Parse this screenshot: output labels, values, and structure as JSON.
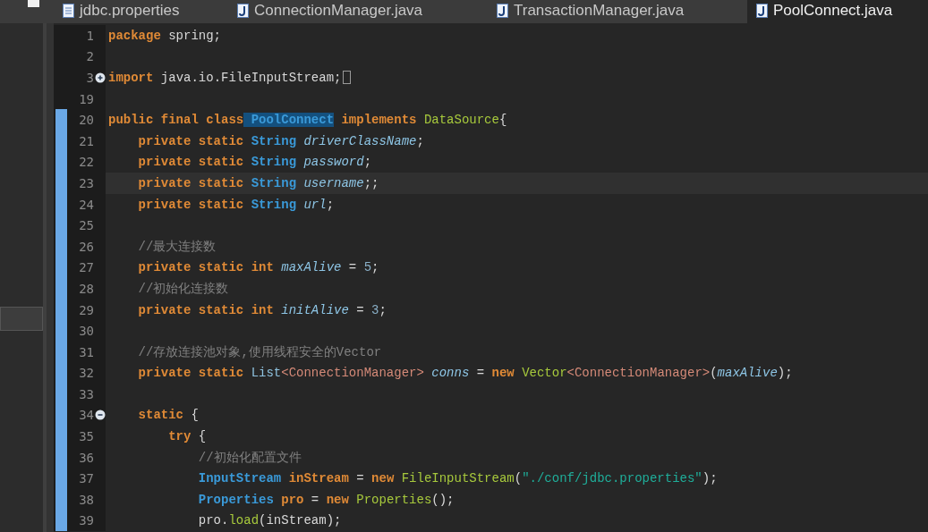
{
  "tabs": [
    {
      "label": "jdbc.properties",
      "kind": "properties",
      "selected": false
    },
    {
      "label": "ConnectionManager.java",
      "kind": "java",
      "selected": false
    },
    {
      "label": "TransactionManager.java",
      "kind": "java",
      "selected": false
    },
    {
      "label": "PoolConnect.java",
      "kind": "java",
      "selected": true
    }
  ],
  "lines": [
    {
      "number": "1",
      "changed": false,
      "current": false,
      "tokens": [
        {
          "kind": "keyword",
          "text": "package"
        },
        {
          "kind": "plain",
          "text": " spring;"
        }
      ]
    },
    {
      "number": "2",
      "changed": false,
      "current": false
    },
    {
      "number": "3",
      "fold_collapsed": true,
      "changed": false,
      "current": false,
      "tokens": [
        {
          "kind": "keyword",
          "text": "import"
        },
        {
          "kind": "plain",
          "text": " java.io.FileInputStream;"
        }
      ]
    },
    {
      "number": "19",
      "changed": false,
      "current": false
    },
    {
      "number": "20",
      "changed": true,
      "current": false,
      "tokens": [
        {
          "kind": "keyword",
          "text": "public final class"
        },
        {
          "kind": "occurrence",
          "text": " PoolConnect"
        },
        {
          "kind": "keyword",
          "text": " implements"
        },
        {
          "kind": "class",
          "text": " DataSource"
        },
        {
          "kind": "plain",
          "text": "{"
        }
      ]
    },
    {
      "number": "21",
      "changed": true,
      "current": false,
      "tokens": [
        {
          "kind": "keyword",
          "text": "    private static"
        },
        {
          "kind": "type",
          "text": " String"
        },
        {
          "kind": "field",
          "text": " driverClassName"
        },
        {
          "kind": "plain",
          "text": ";"
        }
      ]
    },
    {
      "number": "22",
      "changed": true,
      "current": false,
      "tokens": [
        {
          "kind": "keyword",
          "text": "    private static"
        },
        {
          "kind": "type",
          "text": " String"
        },
        {
          "kind": "field",
          "text": " password"
        },
        {
          "kind": "plain",
          "text": ";"
        }
      ]
    },
    {
      "number": "23",
      "changed": true,
      "current": true,
      "tokens": [
        {
          "kind": "keyword",
          "text": "    private static"
        },
        {
          "kind": "type",
          "text": " String"
        },
        {
          "kind": "field",
          "text": " username"
        },
        {
          "kind": "plain",
          "text": ";;"
        }
      ]
    },
    {
      "number": "24",
      "changed": true,
      "current": false,
      "tokens": [
        {
          "kind": "keyword",
          "text": "    private static"
        },
        {
          "kind": "type",
          "text": " String"
        },
        {
          "kind": "field",
          "text": " url"
        },
        {
          "kind": "plain",
          "text": ";"
        }
      ]
    },
    {
      "number": "25",
      "changed": true,
      "current": false
    },
    {
      "number": "26",
      "changed": true,
      "current": false,
      "tokens": [
        {
          "kind": "comment",
          "text": "    //最大连接数"
        }
      ]
    },
    {
      "number": "27",
      "changed": true,
      "current": false,
      "tokens": [
        {
          "kind": "keyword",
          "text": "    private static int"
        },
        {
          "kind": "field",
          "text": " maxAlive"
        },
        {
          "kind": "plain",
          "text": " = "
        },
        {
          "kind": "number",
          "text": "5"
        },
        {
          "kind": "plain",
          "text": ";"
        }
      ]
    },
    {
      "number": "28",
      "changed": true,
      "current": false,
      "tokens": [
        {
          "kind": "comment",
          "text": "    //初始化连接数"
        }
      ]
    },
    {
      "number": "29",
      "changed": true,
      "current": false,
      "tokens": [
        {
          "kind": "keyword",
          "text": "    private static int"
        },
        {
          "kind": "field",
          "text": " initAlive"
        },
        {
          "kind": "plain",
          "text": " = "
        },
        {
          "kind": "number",
          "text": "3"
        },
        {
          "kind": "plain",
          "text": ";"
        }
      ]
    },
    {
      "number": "30",
      "changed": true,
      "current": false
    },
    {
      "number": "31",
      "changed": true,
      "current": false,
      "tokens": [
        {
          "kind": "comment",
          "text": "    //存放连接池对象,使用线程安全的Vector"
        }
      ]
    },
    {
      "number": "32",
      "changed": true,
      "current": false,
      "tokens": [
        {
          "kind": "keyword",
          "text": "    private static"
        },
        {
          "kind": "type-plain",
          "text": " List"
        },
        {
          "kind": "typeparam",
          "text": "<ConnectionManager>"
        },
        {
          "kind": "field",
          "text": " conns"
        },
        {
          "kind": "plain",
          "text": " = "
        },
        {
          "kind": "keyword",
          "text": "new"
        },
        {
          "kind": "class",
          "text": " Vector"
        },
        {
          "kind": "typeparam",
          "text": "<ConnectionManager>"
        },
        {
          "kind": "plain",
          "text": "("
        },
        {
          "kind": "field",
          "text": "maxAlive"
        },
        {
          "kind": "plain",
          "text": ");"
        }
      ]
    },
    {
      "number": "33",
      "changed": true,
      "current": false
    },
    {
      "number": "34",
      "fold_collapsed": false,
      "changed": true,
      "current": false,
      "tokens": [
        {
          "kind": "keyword",
          "text": "    static"
        },
        {
          "kind": "plain",
          "text": " {"
        }
      ]
    },
    {
      "number": "35",
      "changed": true,
      "current": false,
      "tokens": [
        {
          "kind": "keyword",
          "text": "        try"
        },
        {
          "kind": "plain",
          "text": " {"
        }
      ]
    },
    {
      "number": "36",
      "changed": true,
      "current": false,
      "tokens": [
        {
          "kind": "comment",
          "text": "            //初始化配置文件"
        }
      ]
    },
    {
      "number": "37",
      "changed": true,
      "current": false,
      "tokens": [
        {
          "kind": "type",
          "text": "            InputStream"
        },
        {
          "kind": "local",
          "text": " inStream"
        },
        {
          "kind": "plain",
          "text": " = "
        },
        {
          "kind": "keyword",
          "text": "new"
        },
        {
          "kind": "class",
          "text": " FileInputStream"
        },
        {
          "kind": "plain",
          "text": "("
        },
        {
          "kind": "string",
          "text": "\"./conf/jdbc.properties\""
        },
        {
          "kind": "plain",
          "text": ");"
        }
      ]
    },
    {
      "number": "38",
      "changed": true,
      "current": false,
      "tokens": [
        {
          "kind": "type",
          "text": "            Properties"
        },
        {
          "kind": "local",
          "text": " pro"
        },
        {
          "kind": "plain",
          "text": " = "
        },
        {
          "kind": "keyword",
          "text": "new"
        },
        {
          "kind": "class",
          "text": " Properties"
        },
        {
          "kind": "plain",
          "text": "();"
        }
      ]
    },
    {
      "number": "39",
      "changed": true,
      "current": false,
      "tokens": [
        {
          "kind": "plain",
          "text": "            pro."
        },
        {
          "kind": "class",
          "text": "load"
        },
        {
          "kind": "plain",
          "text": "(inStream);"
        }
      ]
    }
  ]
}
